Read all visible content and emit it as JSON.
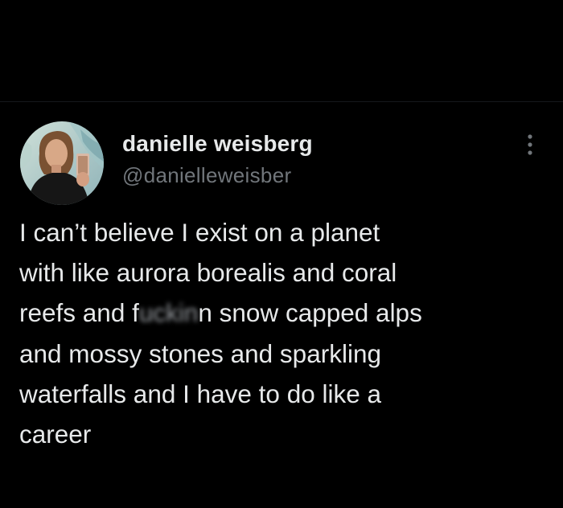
{
  "tweet": {
    "author": {
      "display_name": "danielle weisberg",
      "handle": "@danielleweisber",
      "avatar_icon": "profile-photo"
    },
    "menu_icon": "more-options-icon",
    "text_lines": [
      "I can’t believe I exist on a planet",
      "with like aurora borealis and coral",
      "reefs and f",
      "n snow capped alps",
      "and mossy stones and sparkling",
      "waterfalls and I have to do like a",
      "career"
    ],
    "censored_fragment": "uckin"
  },
  "colors": {
    "background": "#000000",
    "primary_text": "#e7e9ea",
    "secondary_text": "#71767b"
  }
}
